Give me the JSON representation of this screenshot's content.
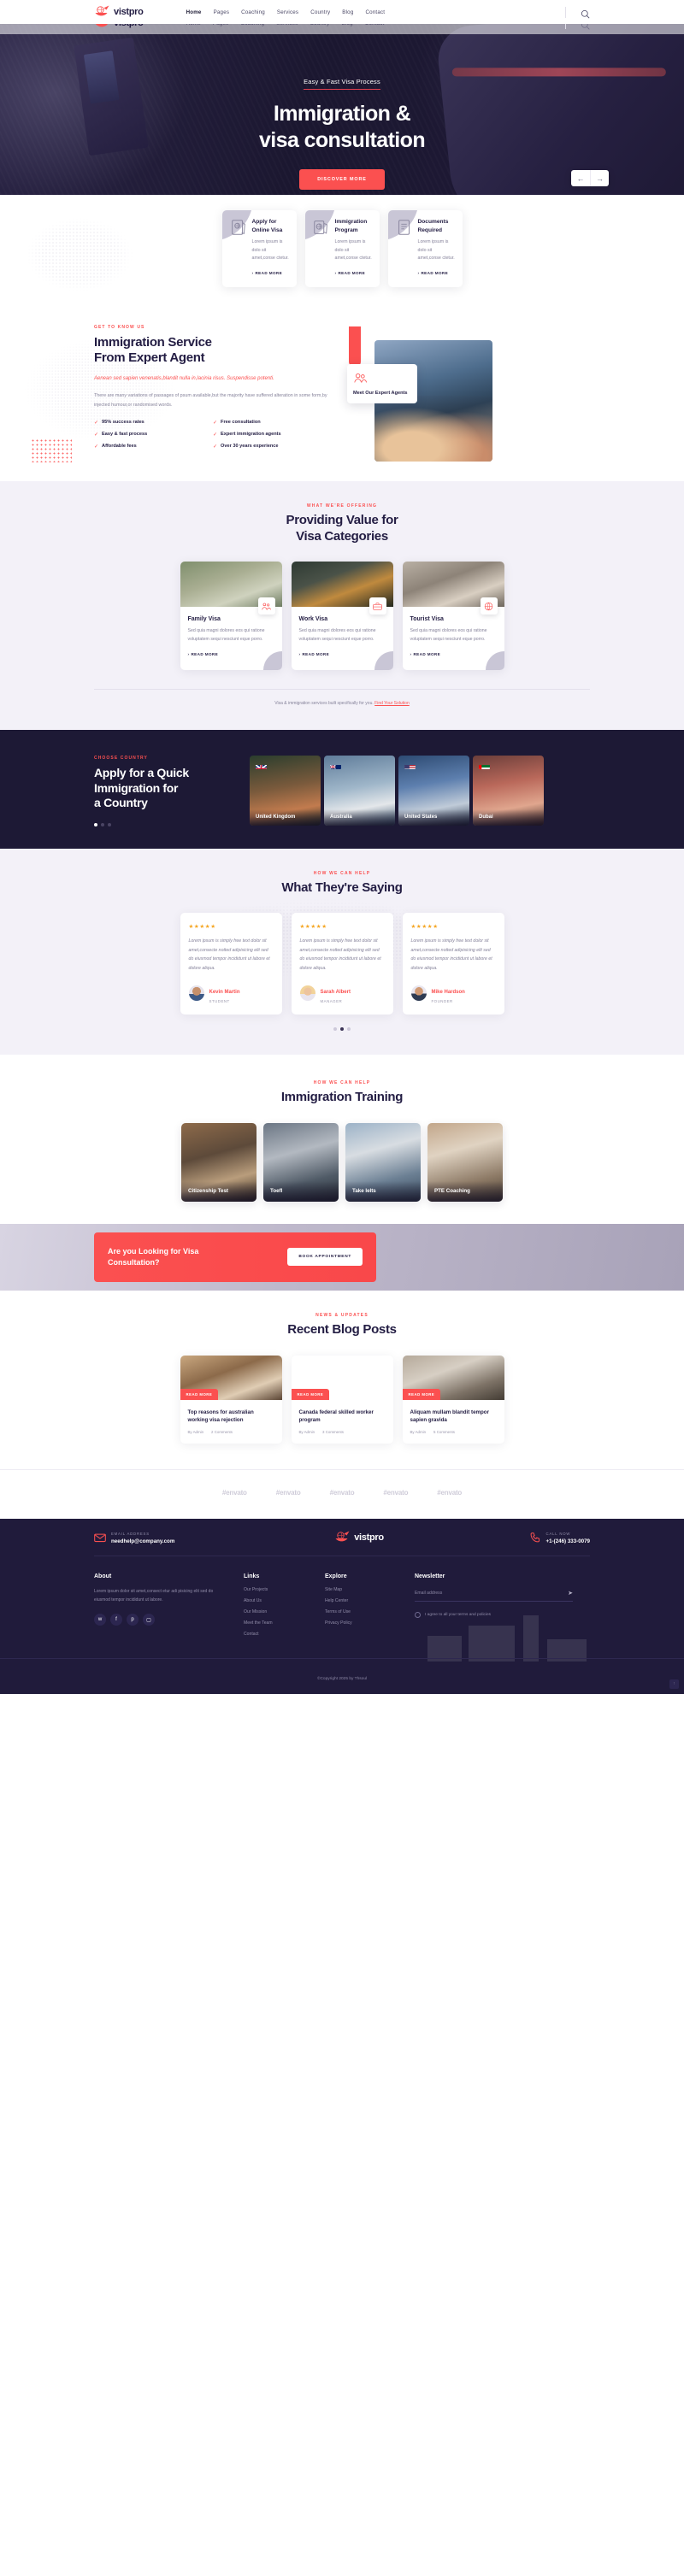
{
  "brand": {
    "name": "vistpro",
    "accent": "#fb5050",
    "dark": "#1d1935"
  },
  "header": {
    "nav": [
      {
        "label": "Home",
        "active": true
      },
      {
        "label": "Pages",
        "active": false
      },
      {
        "label": "Coaching",
        "active": false
      },
      {
        "label": "Services",
        "active": false
      },
      {
        "label": "Country",
        "active": false
      },
      {
        "label": "Blog",
        "active": false
      },
      {
        "label": "Contact",
        "active": false
      }
    ],
    "search_icon": "search-icon"
  },
  "hero": {
    "eyebrow": "Easy & Fast Visa Process",
    "title_line1": "Immigration &",
    "title_line2": "visa consultation",
    "cta": "DISCOVER MORE",
    "prev": "←",
    "next": "→"
  },
  "services": [
    {
      "title": "Apply for Online Visa",
      "desc": "Lorem ipsum is dolo sit amet,conse ctetur.",
      "link": "READ MORE",
      "icon": "passport-icon"
    },
    {
      "title": "Immigration Program",
      "desc": "Lorem ipsum is dolo sit amet,conse ctetur.",
      "link": "READ MORE",
      "icon": "globe-passport-icon"
    },
    {
      "title": "Documents Required",
      "desc": "Lorem ipsum is dolo sit amet,conse ctetur.",
      "link": "READ MORE",
      "icon": "document-icon"
    }
  ],
  "about": {
    "eyebrow": "GET TO KNOW US",
    "title_line1": "Immigration Service",
    "title_line2": "From Expert Agent",
    "lead": "Aenean sed sapien venenatis,blandit nulla in,lacinia risus. Suspendisse potenti.",
    "para": "There are many variations of passages of psum available,but the majority have suffered alteration in some form,by injected humour,or randomised words.",
    "features": [
      "95% success rates",
      "Free consultation",
      "Easy & fast process",
      "Expert immigration agents",
      "Affordable fees",
      "Over 30 years experience"
    ],
    "badge_title": "Meet Our Expert Agents",
    "badge_icon": "agents-icon"
  },
  "categories": {
    "eyebrow": "WHAT WE'RE OFFERING",
    "title_line1": "Providing Value for",
    "title_line2": "Visa Categories",
    "cards": [
      {
        "title": "Family Visa",
        "desc": "Sed quia magni dolores eos qui ratione voluptatem sequi nesciunt eque porro.",
        "link": "READ MORE",
        "icon": "family-icon"
      },
      {
        "title": "Work Visa",
        "desc": "Sed quia magni dolores eos qui ratione voluptatem sequi nesciunt eque porro.",
        "link": "READ MORE",
        "icon": "work-icon"
      },
      {
        "title": "Tourist Visa",
        "desc": "Sed quia magni dolores eos qui ratione voluptatem sequi nesciunt eque porro.",
        "link": "READ MORE",
        "icon": "tourist-icon"
      }
    ],
    "note_text": "Visa & immigration services built specifically for you.",
    "note_link": "Find Your Solution"
  },
  "country": {
    "eyebrow": "CHOOSE COUNTRY",
    "title_line1": "Apply for a Quick",
    "title_line2": "Immigration for",
    "title_line3": "a Country",
    "cards": [
      {
        "name": "United Kingdom",
        "flag": "uk-flag-icon"
      },
      {
        "name": "Australia",
        "flag": "australia-flag-icon"
      },
      {
        "name": "United States",
        "flag": "usa-flag-icon"
      },
      {
        "name": "Dubai",
        "flag": "uae-flag-icon"
      }
    ],
    "pager": [
      true,
      false,
      false
    ]
  },
  "testimonials": {
    "eyebrow": "HOW WE CAN HELP",
    "title": "What They're Saying",
    "items": [
      {
        "stars": "★★★★★",
        "quote": "Lorem ipsum is simply free text dolor sit amet,consecte notted adipisicing elit sed do eiusmod tempor incididunt ut labore et dolore aliqua.",
        "name": "Kevin Martin",
        "role": "STUDENT"
      },
      {
        "stars": "★★★★★",
        "quote": "Lorem ipsum is simply free text dolor sit amet,consecte notted adipisicing elit sed do eiusmod tempor incididunt ut labore et dolore aliqua.",
        "name": "Sarah Albert",
        "role": "MANAGER"
      },
      {
        "stars": "★★★★★",
        "quote": "Lorem ipsum is simply free text dolor sit amet,consecte notted adipisicing elit sed do eiusmod tempor incididunt ut labore et dolore aliqua.",
        "name": "Mike Hardson",
        "role": "FOUNDER"
      }
    ],
    "pager": [
      false,
      true,
      false
    ]
  },
  "training": {
    "eyebrow": "HOW WE CAN HELP",
    "title": "Immigration Training",
    "cards": [
      {
        "label": "Citizenship Test"
      },
      {
        "label": "Toefl"
      },
      {
        "label": "Take Ielts"
      },
      {
        "label": "PTE Coaching"
      }
    ]
  },
  "cta": {
    "title_line1": "Are you Looking for Visa",
    "title_line2": "Consultation?",
    "button": "BOOK APPOINTMENT"
  },
  "blog": {
    "eyebrow": "NEWS & UPDATES",
    "title": "Recent Blog Posts",
    "posts": [
      {
        "tag": "READ MORE",
        "title": "Top reasons for australian working visa rejection",
        "author": "By Admin",
        "comments": "2 Comments"
      },
      {
        "tag": "READ MORE",
        "title": "Canada federal skilled worker program",
        "author": "By Admin",
        "comments": "3 Comments"
      },
      {
        "tag": "READ MORE",
        "title": "Aliquam mullam blandit tempor sapien gravida",
        "author": "By Admin",
        "comments": "5 Comments"
      }
    ]
  },
  "brands": [
    "#envato",
    "#envato",
    "#envato",
    "#envato",
    "#envato"
  ],
  "footer": {
    "email_label": "EMAIL ADDRESS",
    "email_value": "needhelp@company.com",
    "phone_label": "CALL NOW",
    "phone_value": "+1-(246) 333-0079",
    "logo": "vistpro",
    "about": {
      "heading": "About",
      "text": "Lorem ipsum dolor sit amet,consect etur adi pisicing elit sed do eiusmod tempor incididunt ut labore.",
      "socials": [
        "twitter-icon",
        "facebook-icon",
        "pinterest-icon",
        "instagram-icon"
      ]
    },
    "links": {
      "heading": "Links",
      "items": [
        "Our Projects",
        "About Us",
        "Our Mission",
        "Meet the Team",
        "Contact"
      ]
    },
    "explore": {
      "heading": "Explore",
      "items": [
        "Site Map",
        "Help Center",
        "Terms of Use",
        "Privacy Policy"
      ]
    },
    "newsletter": {
      "heading": "Newsletter",
      "placeholder": "Email address",
      "send_icon": "send-icon",
      "agree": "I agree to all your terms and policies"
    },
    "copyright": "©Copyright 2025 by Thsoul",
    "back_to_top": "↑"
  }
}
